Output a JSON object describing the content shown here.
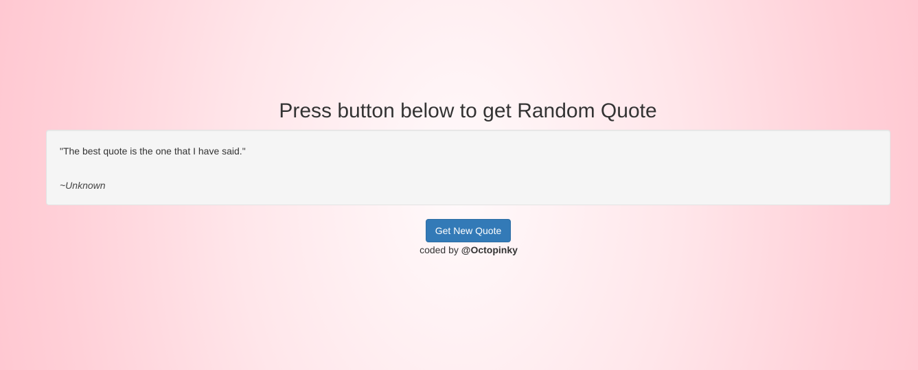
{
  "header": {
    "title": "Press button below to get Random Quote"
  },
  "quote": {
    "text": "\"The best quote is the one that I have said.\"",
    "author": "~Unknown"
  },
  "actions": {
    "new_quote_label": "Get New Quote"
  },
  "footer": {
    "prefix": "coded by ",
    "handle": "@Octopinky"
  },
  "colors": {
    "button_primary": "#337ab7",
    "background_edge": "#ffc6d0",
    "background_center": "#fffafb",
    "well_background": "#f5f5f5"
  }
}
